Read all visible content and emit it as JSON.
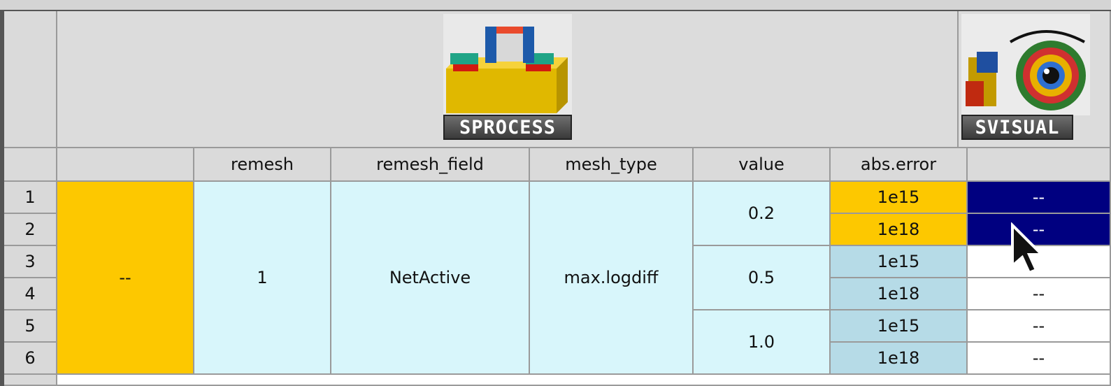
{
  "tools": [
    {
      "name": "SPROCESS",
      "icon": "sprocess-device-icon"
    },
    {
      "name": "SVISUAL",
      "icon": "svisual-eye-icon"
    }
  ],
  "columns": [
    "",
    "remesh",
    "remesh_field",
    "mesh_type",
    "value",
    "abs.error",
    ""
  ],
  "rows": [
    "1",
    "2",
    "3",
    "4",
    "5",
    "6"
  ],
  "cells": {
    "first": "--",
    "remesh": "1",
    "remesh_field": "NetActive",
    "mesh_type": "max.logdiff",
    "values": [
      "0.2",
      "0.5",
      "1.0"
    ],
    "abs_error": [
      "1e15",
      "1e18",
      "1e15",
      "1e18",
      "1e15",
      "1e18"
    ],
    "svisual": [
      "--",
      "--",
      "",
      "--",
      "--",
      "--"
    ]
  },
  "colors": {
    "selected_yellow": "#fdc800",
    "cyan_cell": "#d8f6fb",
    "steel_cell": "#b6dbe7",
    "navy_selected": "#000080"
  }
}
